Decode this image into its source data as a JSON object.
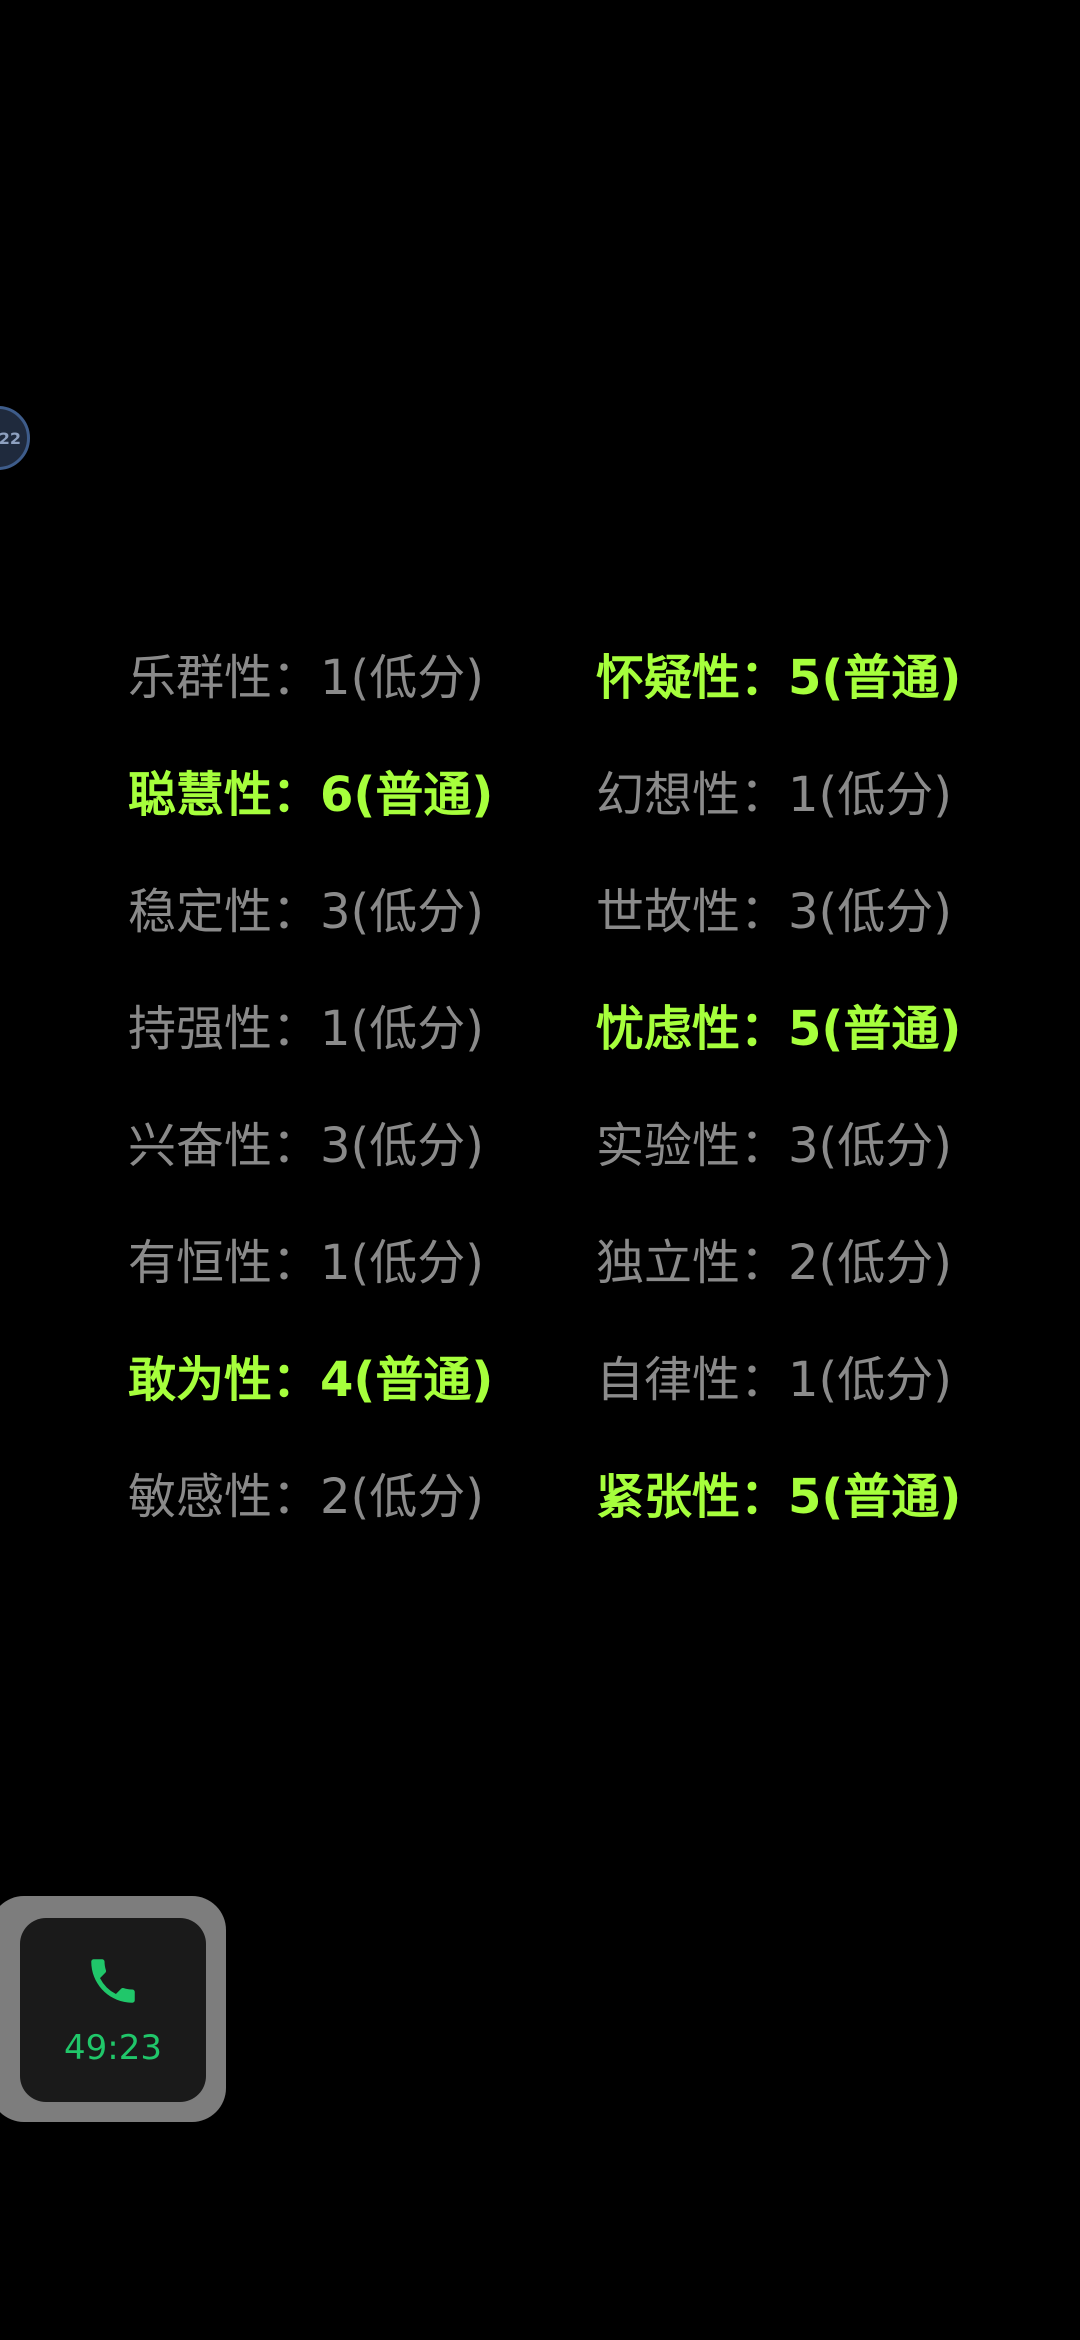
{
  "edge_bubble": {
    "text": "22"
  },
  "colors": {
    "normal": "#a6ff3c",
    "low": "#8a8a8a",
    "call": "#20c76a"
  },
  "traits": [
    {
      "label": "乐群性：1(低分)",
      "level": "low"
    },
    {
      "label": "怀疑性：5(普通)",
      "level": "normal"
    },
    {
      "label": "聪慧性：6(普通)",
      "level": "normal"
    },
    {
      "label": "幻想性：1(低分)",
      "level": "low"
    },
    {
      "label": "稳定性：3(低分)",
      "level": "low"
    },
    {
      "label": "世故性：3(低分)",
      "level": "low"
    },
    {
      "label": "持强性：1(低分)",
      "level": "low"
    },
    {
      "label": "忧虑性：5(普通)",
      "level": "normal"
    },
    {
      "label": "兴奋性：3(低分)",
      "level": "low"
    },
    {
      "label": "实验性：3(低分)",
      "level": "low"
    },
    {
      "label": "有恒性：1(低分)",
      "level": "low"
    },
    {
      "label": "独立性：2(低分)",
      "level": "low"
    },
    {
      "label": "敢为性：4(普通)",
      "level": "normal"
    },
    {
      "label": "自律性：1(低分)",
      "level": "low"
    },
    {
      "label": "敏感性：2(低分)",
      "level": "low"
    },
    {
      "label": "紧张性：5(普通)",
      "level": "normal"
    }
  ],
  "call_widget": {
    "icon": "phone-icon",
    "timer": "49:23"
  }
}
